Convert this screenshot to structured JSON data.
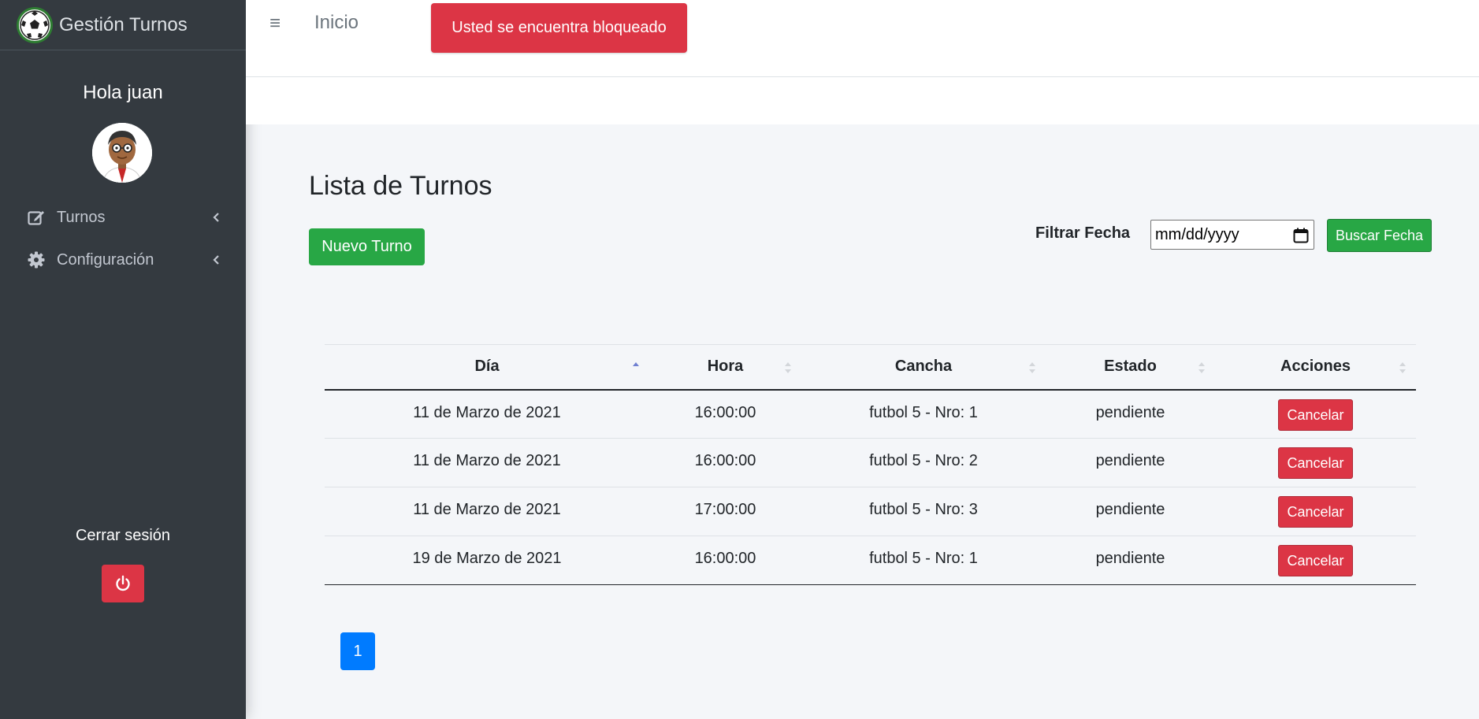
{
  "brand": {
    "title": "Gestión Turnos",
    "logo_icon": "soccer-ball-icon"
  },
  "sidebar": {
    "greeting": "Hola juan",
    "items": [
      {
        "label": "Turnos",
        "icon": "edit-icon"
      },
      {
        "label": "Configuración",
        "icon": "gear-icon"
      }
    ],
    "logout_label": "Cerrar sesión",
    "logout_icon": "power-icon"
  },
  "navbar": {
    "home_link": "Inicio",
    "menu_icon": "hamburger-icon",
    "alert": "Usted se encuentra bloqueado"
  },
  "main": {
    "title": "Lista de Turnos",
    "new_button": "Nuevo Turno",
    "filter_label": "Filtrar Fecha",
    "date_placeholder": "mm/dd/yyyy",
    "search_button": "Buscar Fecha"
  },
  "table": {
    "headers": [
      "Día",
      "Hora",
      "Cancha",
      "Estado",
      "Acciones"
    ],
    "sorted_column": "Día",
    "rows": [
      {
        "dia": "11 de Marzo de 2021",
        "hora": "16:00:00",
        "cancha": "futbol 5 - Nro: 1",
        "estado": "pendiente",
        "accion": "Cancelar"
      },
      {
        "dia": "11 de Marzo de 2021",
        "hora": "16:00:00",
        "cancha": "futbol 5 - Nro: 2",
        "estado": "pendiente",
        "accion": "Cancelar"
      },
      {
        "dia": "11 de Marzo de 2021",
        "hora": "17:00:00",
        "cancha": "futbol 5 - Nro: 3",
        "estado": "pendiente",
        "accion": "Cancelar"
      },
      {
        "dia": "19 de Marzo de 2021",
        "hora": "16:00:00",
        "cancha": "futbol 5 - Nro: 1",
        "estado": "pendiente",
        "accion": "Cancelar"
      }
    ]
  },
  "pagination": {
    "current": "1"
  },
  "colors": {
    "sidebar_bg": "#343a40",
    "danger": "#dc3545",
    "success": "#28a745",
    "primary": "#007bff",
    "content_bg": "#f4f6f9"
  }
}
